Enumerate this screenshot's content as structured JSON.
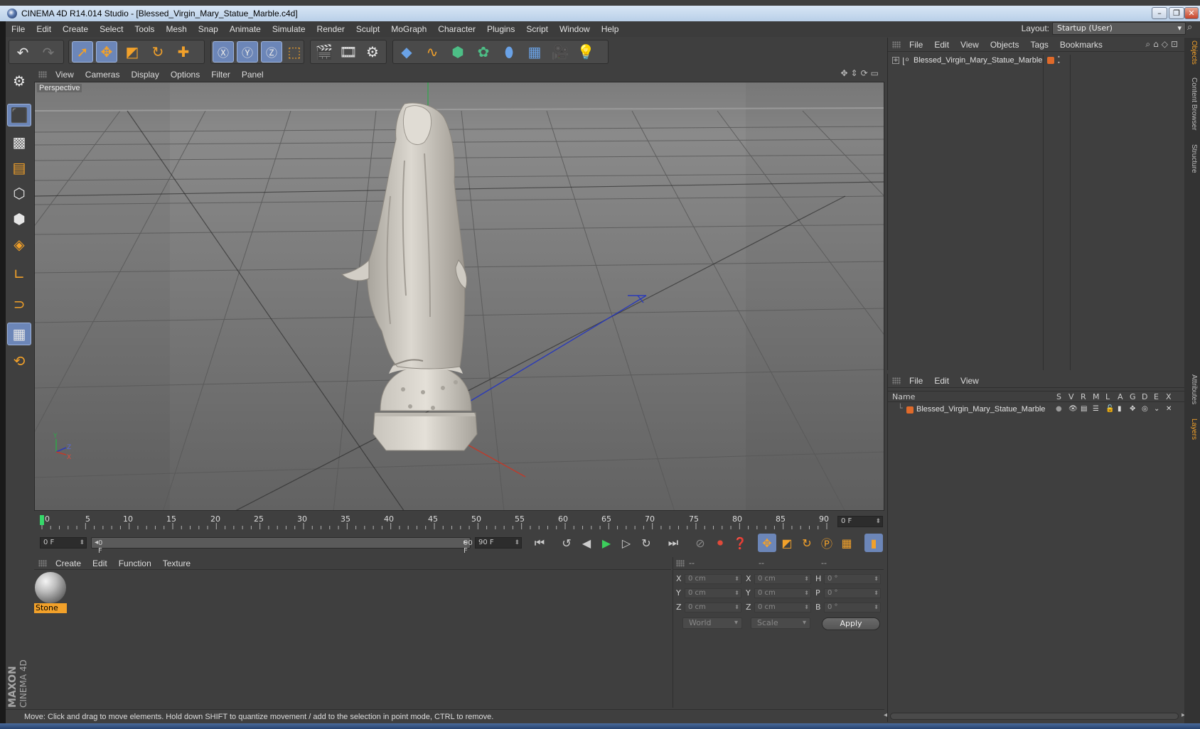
{
  "window": {
    "title": "CINEMA 4D R14.014 Studio - [Blessed_Virgin_Mary_Statue_Marble.c4d]",
    "controls": [
      "–",
      "❐",
      "✕"
    ]
  },
  "menubar": [
    "File",
    "Edit",
    "Create",
    "Select",
    "Tools",
    "Mesh",
    "Snap",
    "Animate",
    "Simulate",
    "Render",
    "Sculpt",
    "MoGraph",
    "Character",
    "Plugins",
    "Script",
    "Window",
    "Help"
  ],
  "layout": {
    "label": "Layout:",
    "value": "Startup (User)"
  },
  "viewport": {
    "menu": [
      "View",
      "Cameras",
      "Display",
      "Options",
      "Filter",
      "Panel"
    ],
    "label": "Perspective",
    "axes": {
      "y": "Y",
      "z": "Z",
      "x": "X"
    }
  },
  "timeline": {
    "ticks": [
      "0",
      "5",
      "10",
      "15",
      "20",
      "25",
      "30",
      "35",
      "40",
      "45",
      "50",
      "55",
      "60",
      "65",
      "70",
      "75",
      "80",
      "85",
      "90"
    ],
    "current_frame": "0 F",
    "start_field": "0 F",
    "range_start": "0 F",
    "range_end": "90 F",
    "end_field": "90 F"
  },
  "materials": {
    "menu": [
      "Create",
      "Edit",
      "Function",
      "Texture"
    ],
    "items": [
      {
        "name": "Stone"
      }
    ]
  },
  "coordinates": {
    "headers": [
      "--",
      "--",
      "--"
    ],
    "rows": [
      {
        "a1": "X",
        "v1": "0 cm",
        "a2": "X",
        "v2": "0 cm",
        "a3": "H",
        "v3": "0 °"
      },
      {
        "a1": "Y",
        "v1": "0 cm",
        "a2": "Y",
        "v2": "0 cm",
        "a3": "P",
        "v3": "0 °"
      },
      {
        "a1": "Z",
        "v1": "0 cm",
        "a2": "Z",
        "v2": "0 cm",
        "a3": "B",
        "v3": "0 °"
      }
    ],
    "mode_world": "World",
    "mode_scale": "Scale",
    "apply": "Apply"
  },
  "status": "Move: Click and drag to move elements. Hold down SHIFT to quantize movement / add to the selection in point mode, CTRL to remove.",
  "objects_panel": {
    "menu": [
      "File",
      "Edit",
      "View",
      "Objects",
      "Tags",
      "Bookmarks"
    ],
    "items": [
      {
        "name": "Blessed_Virgin_Mary_Statue_Marble"
      }
    ]
  },
  "layers_panel": {
    "menu": [
      "File",
      "Edit",
      "View"
    ],
    "columns": [
      "Name",
      "S",
      "V",
      "R",
      "M",
      "L",
      "A",
      "G",
      "D",
      "E",
      "X"
    ],
    "items": [
      {
        "name": "Blessed_Virgin_Mary_Statue_Marble"
      }
    ]
  },
  "side_tabs": [
    "Objects",
    "Content Browser",
    "Structure",
    "Attributes",
    "Layers"
  ],
  "brand": {
    "maxon": "MAXON",
    "product": "CINEMA 4D"
  },
  "colors": {
    "accent": "#f2a12a",
    "selected": "#6c86b8",
    "layer_color": "#e06a2a"
  }
}
